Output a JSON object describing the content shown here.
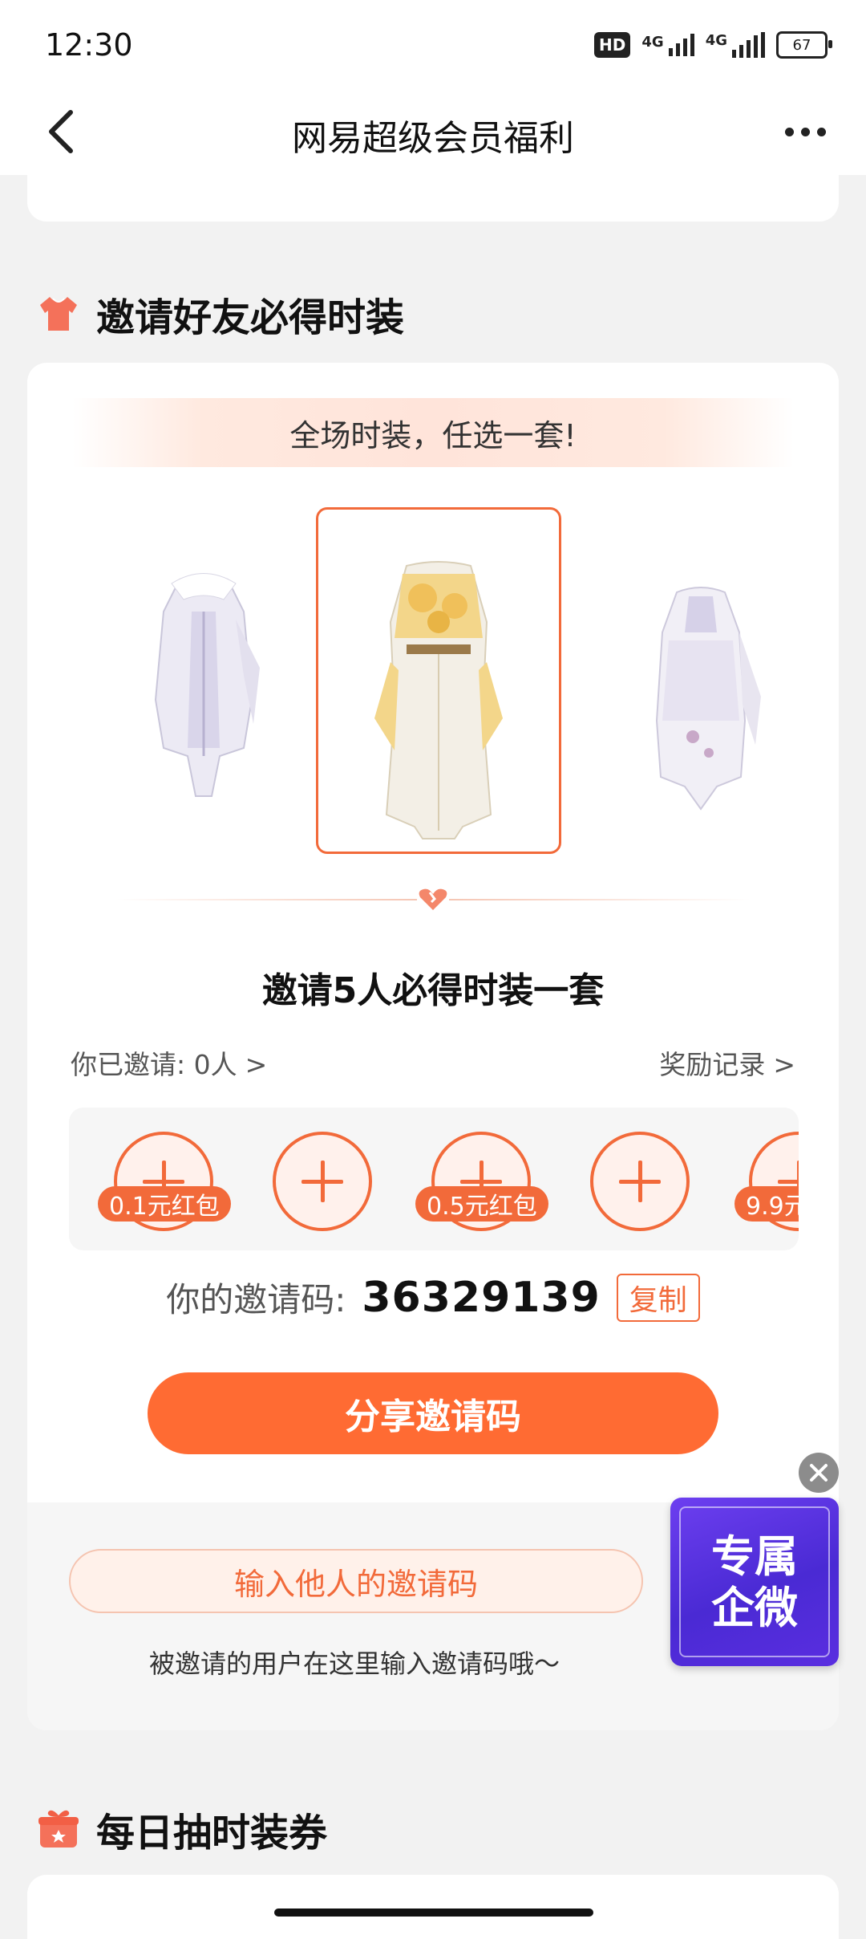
{
  "status_bar": {
    "time": "12:30",
    "hd_label": "HD",
    "network_1": "4G",
    "network_2": "4G",
    "battery": "67"
  },
  "header": {
    "title": "网易超级会员福利",
    "back_icon": "chevron-left-icon",
    "more_icon": "more-horizontal-icon"
  },
  "invite_section": {
    "title": "邀请好友必得时装",
    "icon": "tshirt-icon",
    "banner": "全场时装，任选一套!",
    "outfits": [
      "outfit-left",
      "outfit-center-selected",
      "outfit-right"
    ],
    "goal_title": "邀请5人必得时装一套",
    "invited_label": "你已邀请: 0人",
    "reward_record": "奖励记录",
    "slots": [
      {
        "badge": "0.1元红包"
      },
      {
        "badge": ""
      },
      {
        "badge": "0.5元红包"
      },
      {
        "badge": ""
      },
      {
        "badge": "9.9元"
      }
    ],
    "code_label": "你的邀请码:",
    "code_value": "36329139",
    "copy_label": "复制",
    "share_button": "分享邀请码",
    "input_placeholder": "输入他人的邀请码",
    "input_hint": "被邀请的用户在这里输入邀请码哦～"
  },
  "float_ad": {
    "line1": "专属",
    "line2": "企微"
  },
  "daily_section": {
    "title": "每日抽时装券",
    "icon": "gift-icon"
  },
  "colors": {
    "accent": "#ff6b33",
    "accent_border": "#f26a3a",
    "background": "#f2f2f2"
  }
}
